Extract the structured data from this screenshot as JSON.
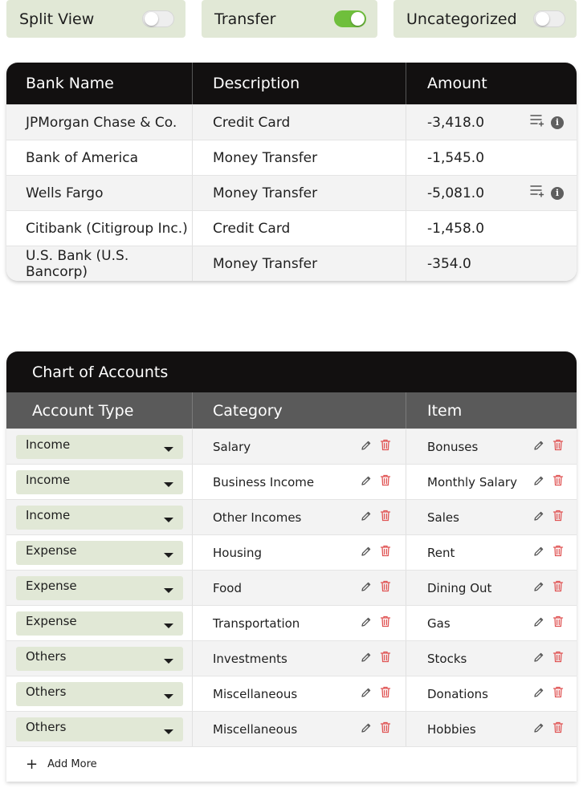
{
  "toggles": [
    {
      "label": "Split View",
      "on": false
    },
    {
      "label": "Transfer",
      "on": true
    },
    {
      "label": "Uncategorized",
      "on": false
    }
  ],
  "bank_table": {
    "headers": [
      "Bank Name",
      "Description",
      "Amount"
    ],
    "rows": [
      {
        "bank": "JPMorgan Chase & Co.",
        "description": "Credit Card",
        "amount": "-3,418.0",
        "has_actions": true
      },
      {
        "bank": "Bank of America",
        "description": "Money Transfer",
        "amount": "-1,545.0",
        "has_actions": false
      },
      {
        "bank": "Wells Fargo",
        "description": "Money Transfer",
        "amount": "-5,081.0",
        "has_actions": true
      },
      {
        "bank": "Citibank (Citigroup Inc.)",
        "description": "Credit Card",
        "amount": "-1,458.0",
        "has_actions": false
      },
      {
        "bank": "U.S. Bank (U.S. Bancorp)",
        "description": "Money Transfer",
        "amount": "-354.0",
        "has_actions": false
      }
    ],
    "info_glyph": "i"
  },
  "chart_of_accounts": {
    "title": "Chart of Accounts",
    "headers": [
      "Account Type",
      "Category",
      "Item"
    ],
    "rows": [
      {
        "type": "Income",
        "category": "Salary",
        "item": "Bonuses"
      },
      {
        "type": "Income",
        "category": "Business Income",
        "item": "Monthly Salary"
      },
      {
        "type": "Income",
        "category": "Other Incomes",
        "item": "Sales"
      },
      {
        "type": "Expense",
        "category": "Housing",
        "item": "Rent"
      },
      {
        "type": "Expense",
        "category": "Food",
        "item": "Dining Out"
      },
      {
        "type": "Expense",
        "category": "Transportation",
        "item": "Gas"
      },
      {
        "type": "Others",
        "category": "Investments",
        "item": "Stocks"
      },
      {
        "type": "Others",
        "category": "Miscellaneous",
        "item": "Donations"
      },
      {
        "type": "Others",
        "category": "Miscellaneous",
        "item": "Hobbies"
      }
    ],
    "add_more": {
      "icon": "+",
      "label": "Add More"
    }
  },
  "colors": {
    "accent_green": "#6fbf3c",
    "toggle_bg": "#e1e8d6",
    "header_dark": "#121010",
    "subheader_gray": "#5a5a5a",
    "delete_red": "#e05555"
  }
}
